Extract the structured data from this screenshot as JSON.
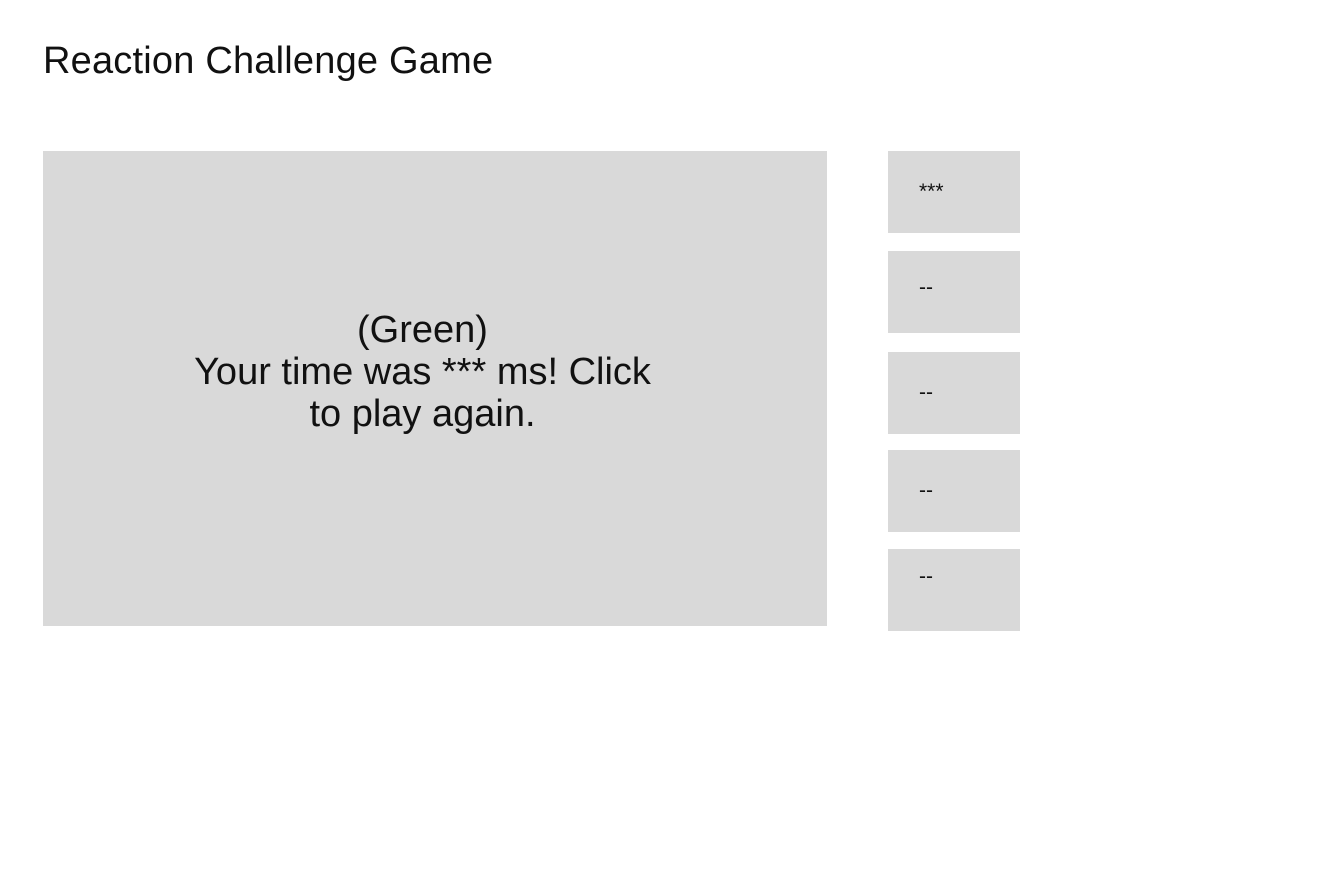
{
  "page": {
    "title": "Reaction Challenge Game"
  },
  "game": {
    "status": "(Green)",
    "message_line1": "Your time was *** ms! Click",
    "message_line2": "to play again.",
    "background_color": "#d9d9d9"
  },
  "scores": [
    {
      "value": "***"
    },
    {
      "value": "--"
    },
    {
      "value": "--"
    },
    {
      "value": "--"
    },
    {
      "value": "--"
    }
  ]
}
